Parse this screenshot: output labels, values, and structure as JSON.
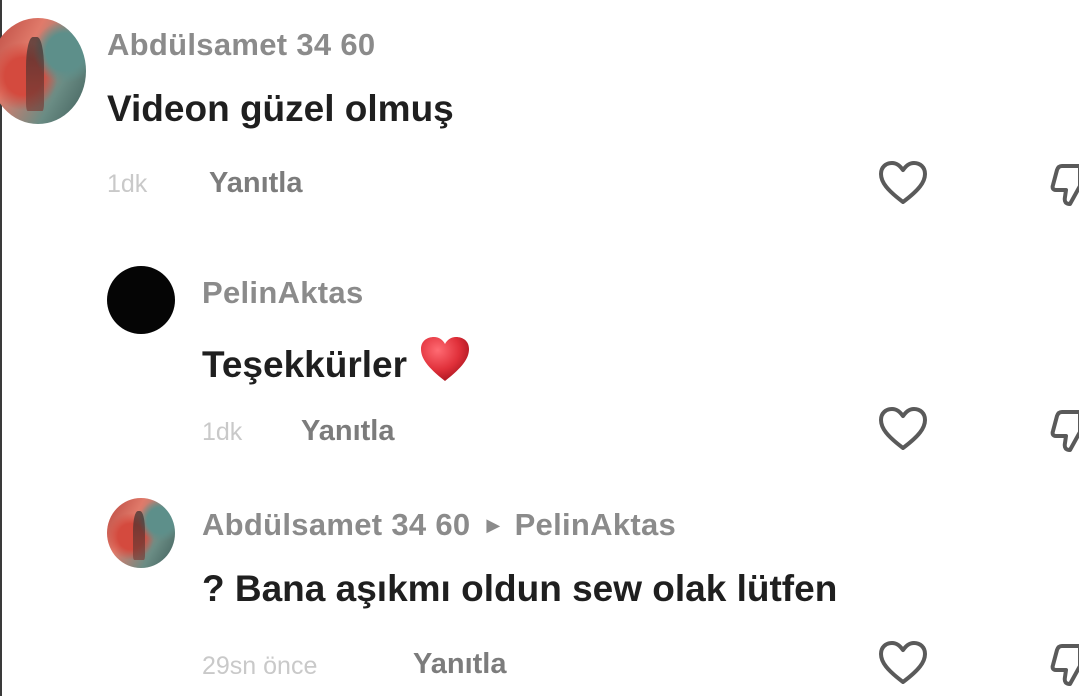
{
  "comments": [
    {
      "username": "Abdülsamet 34 60",
      "text": "Videon güzel olmuş",
      "time": "1dk",
      "reply_label": "Yanıtla",
      "avatar": "photo-avatar"
    },
    {
      "username": "PelinAktas",
      "text": "Teşekkürler",
      "emoji": "red-heart-emoji",
      "time": "1dk",
      "reply_label": "Yanıtla",
      "avatar": "black-avatar"
    },
    {
      "username": "Abdülsamet 34 60",
      "reply_to": "PelinAktas",
      "text": "? Bana aşıkmı oldun sew olak lütfen",
      "time": "29sn önce",
      "reply_label": "Yanıtla",
      "avatar": "photo-avatar"
    }
  ],
  "icons": {
    "like": "heart-outline-icon",
    "dislike": "thumbs-down-icon",
    "reply_arrow": "right-triangle-icon"
  },
  "colors": {
    "username": "#8b8b8b",
    "text": "#1f1f1f",
    "time": "#c9c9c9",
    "reply": "#7c7c7c",
    "heart_emoji": "#e0303a"
  }
}
